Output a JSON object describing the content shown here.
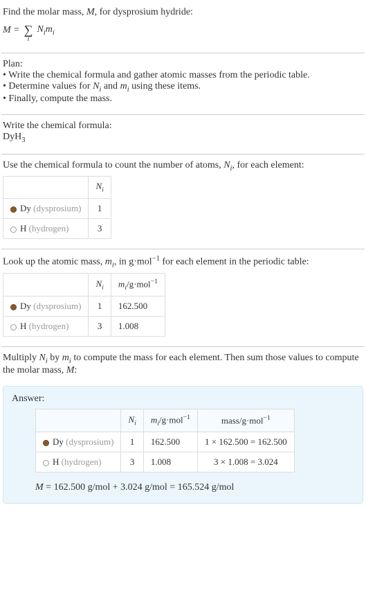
{
  "intro": {
    "line1": "Find the molar mass, ",
    "Mvar": "M",
    "line1b": ", for dysprosium hydride:",
    "eq_left": "M = ",
    "eq_right": " N",
    "eq_i": "i",
    "eq_m": "m",
    "sigma_index": "i"
  },
  "plan": {
    "heading": "Plan:",
    "b1": "• Write the chemical formula and gather atomic masses from the periodic table.",
    "b2_a": "• Determine values for ",
    "b2_N": "N",
    "b2_i": "i",
    "b2_and": " and ",
    "b2_m": "m",
    "b2_i2": "i",
    "b2_b": " using these items.",
    "b3": "• Finally, compute the mass."
  },
  "formula_section": {
    "heading": "Write the chemical formula:",
    "compound_a": "DyH",
    "compound_sub": "3"
  },
  "count_section": {
    "text_a": "Use the chemical formula to count the number of atoms, ",
    "N": "N",
    "i": "i",
    "text_b": ", for each element:",
    "col_N": "N",
    "col_i": "i",
    "rows": [
      {
        "sym": "Dy",
        "name": "(dysprosium)",
        "n": "1",
        "dot": "dot-dy"
      },
      {
        "sym": "H",
        "name": "(hydrogen)",
        "n": "3",
        "dot": "dot-h"
      }
    ]
  },
  "mass_section": {
    "text_a": "Look up the atomic mass, ",
    "m": "m",
    "i": "i",
    "text_b": ", in g·mol",
    "neg1": "−1",
    "text_c": " for each element in the periodic table:",
    "col_N": "N",
    "col_Ni": "i",
    "col_m": "m",
    "col_mi": "i",
    "col_unit_a": "/g·mol",
    "col_unit_b": "−1",
    "rows": [
      {
        "sym": "Dy",
        "name": "(dysprosium)",
        "n": "1",
        "mass": "162.500",
        "dot": "dot-dy"
      },
      {
        "sym": "H",
        "name": "(hydrogen)",
        "n": "3",
        "mass": "1.008",
        "dot": "dot-h"
      }
    ]
  },
  "compute_section": {
    "text_a": "Multiply ",
    "N": "N",
    "Ni": "i",
    "text_by": " by ",
    "m": "m",
    "mi": "i",
    "text_b": " to compute the mass for each element. Then sum those values to compute the molar mass, ",
    "Mvar": "M",
    "text_c": ":"
  },
  "answer": {
    "label": "Answer:",
    "col_N": "N",
    "col_Ni": "i",
    "col_m": "m",
    "col_mi": "i",
    "col_unit_a": "/g·mol",
    "col_unit_b": "−1",
    "col_mass_a": "mass/g·mol",
    "col_mass_b": "−1",
    "rows": [
      {
        "sym": "Dy",
        "name": "(dysprosium)",
        "n": "1",
        "mi": "162.500",
        "mass": "1 × 162.500 = 162.500",
        "dot": "dot-dy"
      },
      {
        "sym": "H",
        "name": "(hydrogen)",
        "n": "3",
        "mi": "1.008",
        "mass": "3 × 1.008 = 3.024",
        "dot": "dot-h"
      }
    ],
    "sum_M": "M",
    "sum_rest": " = 162.500 g/mol + 3.024 g/mol = 165.524 g/mol"
  }
}
